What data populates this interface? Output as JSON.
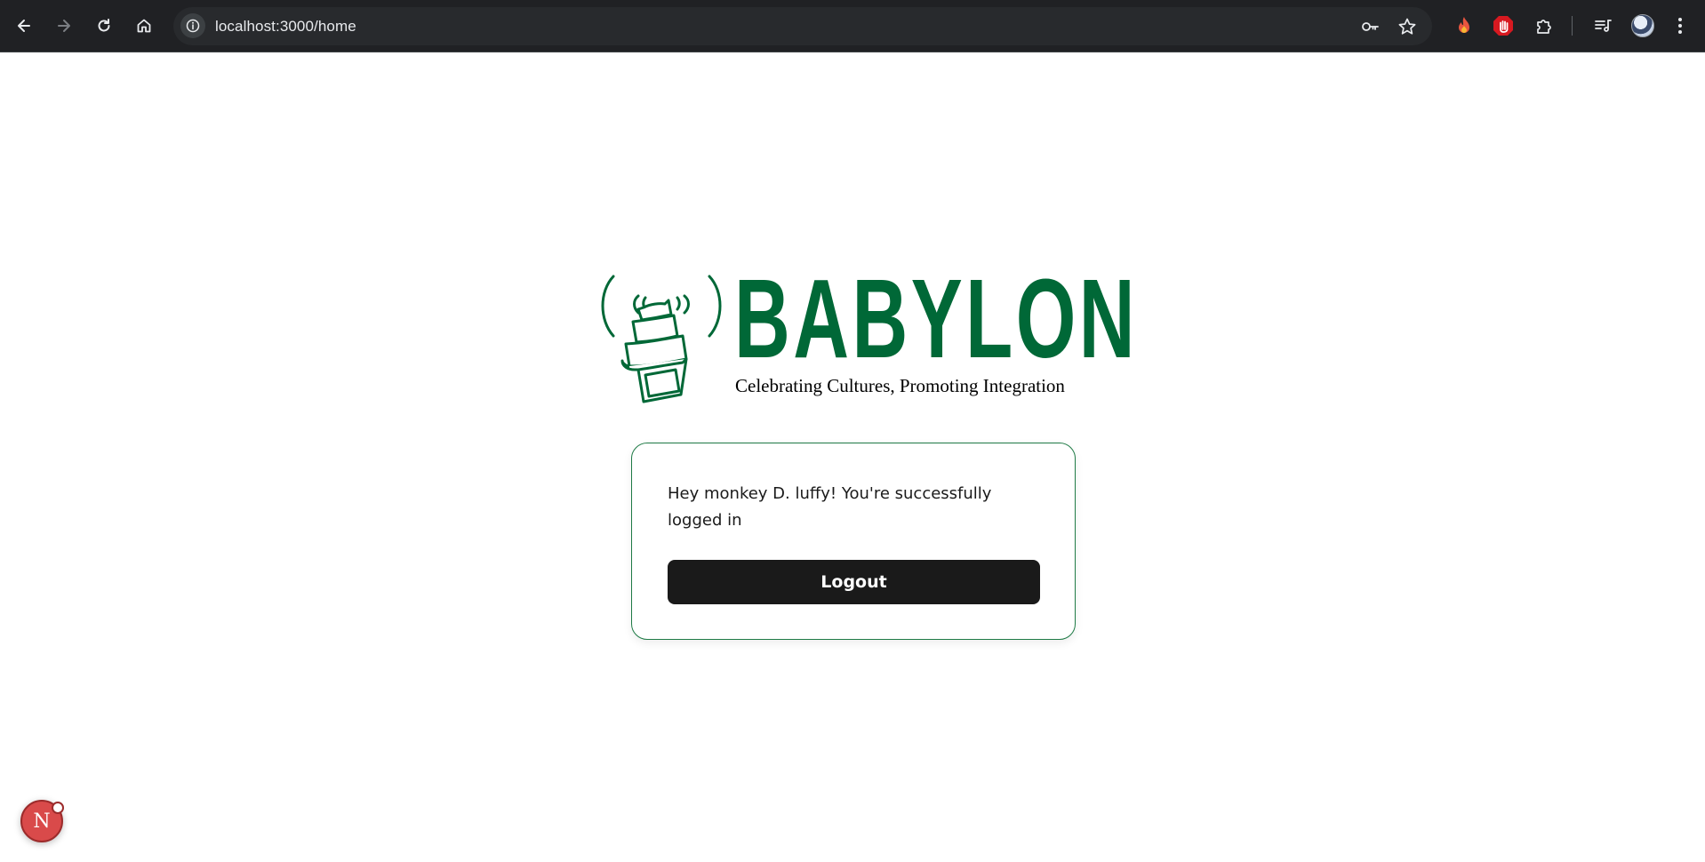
{
  "browser": {
    "url": "localhost:3000/home",
    "icons": [
      "back-arrow-icon",
      "forward-arrow-icon",
      "reload-icon",
      "home-icon",
      "site-info-icon",
      "password-key-icon",
      "bookmark-star-icon",
      "fire-extension-icon",
      "stop-hand-extension-icon",
      "extensions-puzzle-icon",
      "reading-list-icon",
      "profile-avatar-icon",
      "more-menu-icon"
    ]
  },
  "logo": {
    "wordmark": "BABYLON",
    "tagline": "Celebrating Cultures, Promoting Integration",
    "brand_color": "#006837"
  },
  "card": {
    "message": "Hey monkey D. luffy! You're successfully logged in",
    "logout_label": "Logout",
    "border_color": "#1e7a45",
    "button_color": "#1a1a1a"
  },
  "dev_indicator": {
    "label": "N",
    "color": "#d94a4a"
  }
}
